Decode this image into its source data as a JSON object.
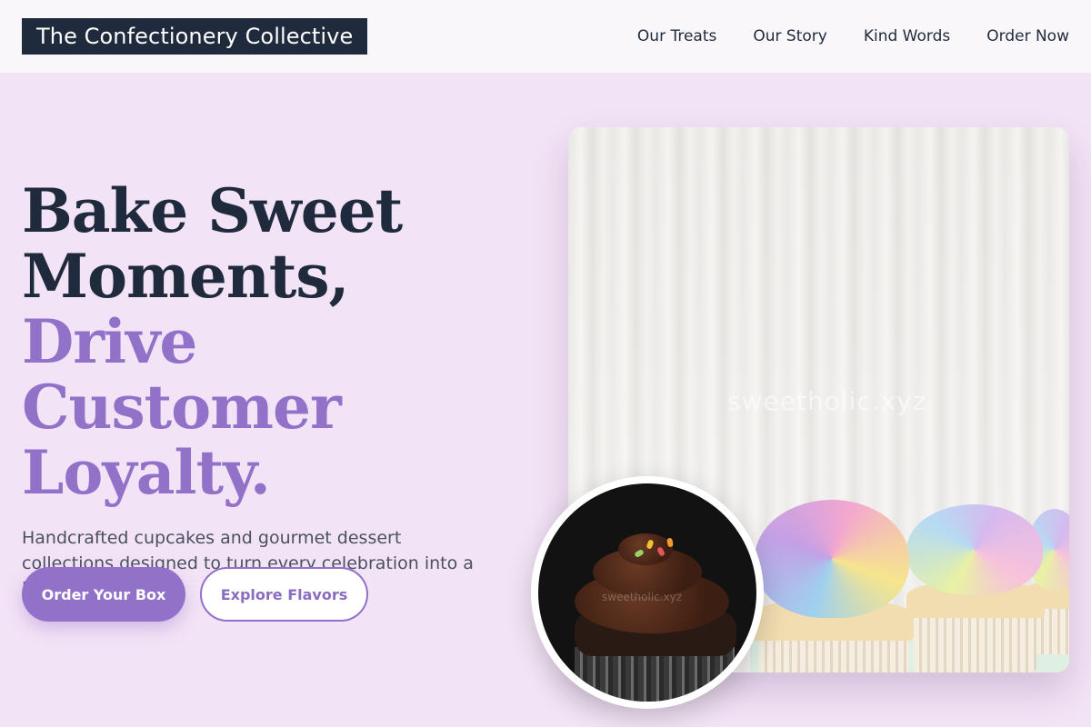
{
  "header": {
    "brand": "The Confectionery Collective",
    "nav": [
      {
        "label": "Our Treats"
      },
      {
        "label": "Our Story"
      },
      {
        "label": "Kind Words"
      },
      {
        "label": "Order Now"
      }
    ]
  },
  "hero": {
    "title_line1": "Bake Sweet",
    "title_line2": "Moments,",
    "title_line3": "Drive Customer",
    "title_line4": "Loyalty.",
    "subtitle": "Handcrafted cupcakes and gourmet dessert collections designed to turn every celebration into a lasting memory.",
    "primary_cta": "Order Your Box",
    "secondary_cta": "Explore Flavors",
    "image_watermark": "sweetholic.xyz",
    "inset_watermark": "sweetholic.xyz"
  },
  "colors": {
    "background": "#f3e3f6",
    "header_bg": "#faf7fb",
    "dark": "#1f2a3c",
    "accent": "#9271c9"
  }
}
